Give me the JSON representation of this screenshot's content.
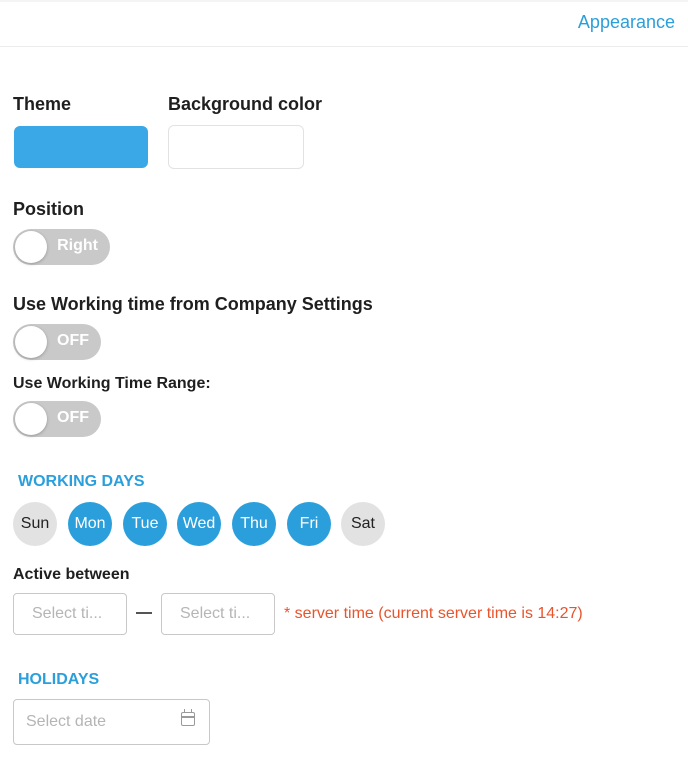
{
  "header": {
    "tab_label": "Appearance"
  },
  "theme": {
    "label": "Theme",
    "color": "#3aa8e6"
  },
  "background": {
    "label": "Background color",
    "color": "#ffffff"
  },
  "position": {
    "label": "Position",
    "toggle_text": "Right"
  },
  "working_time_company": {
    "label": "Use Working time from Company Settings",
    "toggle_text": "OFF"
  },
  "working_time_range": {
    "label": "Use Working Time Range:",
    "toggle_text": "OFF"
  },
  "working_days": {
    "title": "WORKING DAYS",
    "days": [
      {
        "label": "Sun",
        "active": false
      },
      {
        "label": "Mon",
        "active": true
      },
      {
        "label": "Tue",
        "active": true
      },
      {
        "label": "Wed",
        "active": true
      },
      {
        "label": "Thu",
        "active": true
      },
      {
        "label": "Fri",
        "active": true
      },
      {
        "label": "Sat",
        "active": false
      }
    ]
  },
  "active_between": {
    "label": "Active between",
    "start_placeholder": "Select ti...",
    "end_placeholder": "Select ti...",
    "server_note": "* server time (current server time is 14:27)"
  },
  "holidays": {
    "title": "HOLIDAYS",
    "date_placeholder": "Select date"
  },
  "colors": {
    "accent": "#2b9fdb",
    "warning": "#e8542c",
    "toggle_off": "#c9c9c9",
    "day_off": "#e2e2e2"
  }
}
